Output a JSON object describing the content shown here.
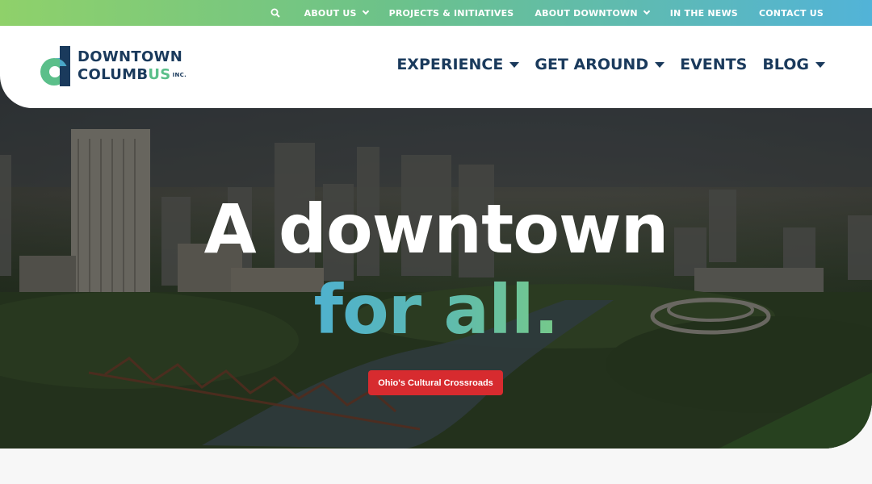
{
  "topbar": {
    "search_icon": "search-icon",
    "items": [
      {
        "label": "ABOUT US",
        "has_dropdown": true
      },
      {
        "label": "PROJECTS & INITIATIVES",
        "has_dropdown": false
      },
      {
        "label": "ABOUT DOWNTOWN",
        "has_dropdown": true
      },
      {
        "label": "IN THE NEWS",
        "has_dropdown": false
      },
      {
        "label": "CONTACT US",
        "has_dropdown": false
      }
    ]
  },
  "logo": {
    "line1": "DOWNTOWN",
    "line2_a": "COLUMB",
    "line2_b": "US",
    "inc": "INC."
  },
  "mainnav": {
    "items": [
      {
        "label": "EXPERIENCE",
        "has_dropdown": true
      },
      {
        "label": "GET AROUND",
        "has_dropdown": true
      },
      {
        "label": "EVENTS",
        "has_dropdown": false
      },
      {
        "label": "BLOG",
        "has_dropdown": true
      }
    ]
  },
  "hero": {
    "headline_line1": "A downtown",
    "headline_line2": "for all.",
    "cta_label": "Ohio's Cultural Crossroads"
  },
  "colors": {
    "navy": "#1a3a5c",
    "green": "#5bbf8a",
    "cta_red": "#d72b2f"
  }
}
